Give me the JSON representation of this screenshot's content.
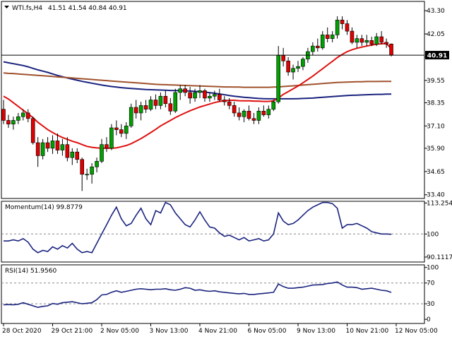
{
  "colors": {
    "bull": "#00a000",
    "bear": "#e00000",
    "ma_fast": "#e01010",
    "ma_mid": "#a0522d",
    "ma_slow": "#1a237e",
    "indicator": "#1a237e",
    "grid": "#888888"
  },
  "chart_data": [
    {
      "type": "candlestick",
      "title": "WTI.fs,H4",
      "ohlc_text": "41.51 41.54 40.84 40.91",
      "current_price_label": "40.91",
      "current_price": 40.91,
      "ylim": [
        33.2,
        43.8
      ],
      "yticks": [
        "43.30",
        "42.05",
        "40.80",
        "39.55",
        "38.35",
        "37.10",
        "35.90",
        "34.65",
        "33.40"
      ],
      "ytick_values": [
        43.3,
        42.05,
        40.8,
        39.55,
        38.35,
        37.1,
        35.9,
        34.65,
        33.4
      ],
      "xticks": [
        "28 Oct 2020",
        "29 Oct 21:00",
        "2 Nov 05:00",
        "3 Nov 13:00",
        "4 Nov 21:00",
        "6 Nov 05:00",
        "9 Nov 13:00",
        "10 Nov 21:00",
        "12 Nov 05:00"
      ],
      "xtick_index": [
        0,
        10,
        20,
        30,
        40,
        50,
        60,
        70,
        80
      ],
      "candles": [
        [
          38.0,
          38.5,
          37.2,
          37.4
        ],
        [
          37.4,
          37.7,
          37.0,
          37.2
        ],
        [
          37.2,
          37.6,
          36.9,
          37.4
        ],
        [
          37.4,
          37.8,
          37.2,
          37.6
        ],
        [
          37.6,
          38.0,
          37.4,
          37.8
        ],
        [
          37.8,
          38.0,
          37.3,
          37.5
        ],
        [
          37.5,
          37.6,
          36.1,
          36.2
        ],
        [
          36.2,
          36.5,
          34.9,
          35.5
        ],
        [
          35.5,
          36.4,
          35.3,
          36.2
        ],
        [
          36.2,
          36.5,
          35.7,
          35.9
        ],
        [
          35.9,
          36.6,
          35.6,
          36.3
        ],
        [
          36.3,
          36.7,
          35.6,
          35.8
        ],
        [
          35.8,
          36.4,
          35.5,
          36.1
        ],
        [
          36.1,
          36.5,
          35.2,
          35.4
        ],
        [
          35.4,
          35.9,
          35.0,
          35.7
        ],
        [
          35.7,
          35.9,
          35.1,
          35.3
        ],
        [
          35.3,
          35.4,
          33.6,
          34.5
        ],
        [
          34.5,
          34.8,
          34.2,
          34.5
        ],
        [
          34.5,
          35.1,
          34.0,
          34.9
        ],
        [
          34.9,
          35.4,
          34.6,
          35.2
        ],
        [
          35.2,
          36.4,
          35.1,
          36.1
        ],
        [
          36.1,
          36.5,
          35.7,
          35.9
        ],
        [
          35.9,
          37.2,
          35.8,
          37.0
        ],
        [
          37.0,
          37.4,
          36.6,
          36.9
        ],
        [
          36.9,
          37.2,
          36.5,
          36.7
        ],
        [
          36.7,
          37.3,
          36.4,
          37.1
        ],
        [
          37.1,
          38.3,
          37.0,
          38.1
        ],
        [
          38.1,
          38.5,
          37.5,
          37.8
        ],
        [
          37.8,
          38.4,
          37.4,
          38.2
        ],
        [
          38.2,
          38.5,
          37.8,
          38.0
        ],
        [
          38.0,
          38.7,
          37.9,
          38.5
        ],
        [
          38.5,
          38.8,
          38.0,
          38.2
        ],
        [
          38.2,
          38.9,
          38.0,
          38.7
        ],
        [
          38.7,
          39.0,
          38.1,
          38.3
        ],
        [
          38.3,
          38.6,
          37.7,
          37.9
        ],
        [
          37.9,
          39.1,
          37.8,
          38.9
        ],
        [
          38.9,
          39.3,
          38.5,
          39.1
        ],
        [
          39.1,
          39.3,
          38.7,
          38.9
        ],
        [
          38.9,
          39.2,
          38.3,
          38.6
        ],
        [
          38.6,
          39.1,
          38.4,
          38.9
        ],
        [
          38.9,
          39.3,
          38.6,
          39.0
        ],
        [
          39.0,
          39.1,
          38.4,
          38.6
        ],
        [
          38.6,
          38.9,
          38.4,
          38.7
        ],
        [
          38.7,
          39.0,
          38.5,
          38.8
        ],
        [
          38.8,
          39.1,
          38.4,
          38.5
        ],
        [
          38.5,
          38.7,
          38.2,
          38.4
        ],
        [
          38.4,
          38.6,
          38.0,
          38.2
        ],
        [
          38.2,
          38.4,
          37.6,
          37.8
        ],
        [
          37.8,
          38.1,
          37.4,
          37.6
        ],
        [
          37.6,
          38.0,
          37.3,
          37.9
        ],
        [
          37.9,
          38.2,
          37.4,
          37.5
        ],
        [
          37.5,
          37.8,
          37.2,
          37.4
        ],
        [
          37.4,
          38.1,
          37.2,
          37.9
        ],
        [
          37.9,
          38.2,
          37.6,
          37.7
        ],
        [
          37.7,
          38.2,
          37.5,
          38.0
        ],
        [
          38.0,
          38.5,
          37.9,
          38.4
        ],
        [
          38.4,
          41.4,
          38.3,
          40.9
        ],
        [
          40.9,
          41.3,
          40.3,
          40.6
        ],
        [
          40.6,
          40.8,
          39.8,
          40.0
        ],
        [
          40.0,
          40.4,
          39.6,
          40.2
        ],
        [
          40.2,
          40.6,
          40.0,
          40.3
        ],
        [
          40.3,
          40.8,
          40.1,
          40.7
        ],
        [
          40.7,
          41.3,
          40.5,
          41.1
        ],
        [
          41.1,
          41.6,
          40.9,
          41.4
        ],
        [
          41.4,
          41.8,
          41.1,
          41.3
        ],
        [
          41.3,
          42.2,
          41.2,
          42.0
        ],
        [
          42.0,
          42.4,
          41.6,
          41.8
        ],
        [
          41.8,
          42.2,
          41.6,
          42.0
        ],
        [
          42.0,
          43.0,
          41.8,
          42.8
        ],
        [
          42.8,
          43.0,
          42.3,
          42.6
        ],
        [
          42.6,
          42.8,
          42.0,
          42.2
        ],
        [
          42.2,
          42.4,
          41.5,
          41.6
        ],
        [
          41.6,
          42.0,
          41.3,
          41.8
        ],
        [
          41.8,
          42.0,
          41.4,
          41.6
        ],
        [
          41.6,
          42.0,
          41.4,
          41.7
        ],
        [
          41.7,
          41.9,
          41.4,
          41.5
        ],
        [
          41.5,
          42.1,
          41.4,
          41.9
        ],
        [
          41.9,
          42.2,
          41.5,
          41.6
        ],
        [
          41.6,
          41.8,
          41.3,
          41.51
        ],
        [
          41.51,
          41.54,
          40.84,
          40.91
        ]
      ],
      "ma_fast": [
        38.7,
        38.55,
        38.35,
        38.15,
        37.95,
        37.75,
        37.55,
        37.3,
        37.1,
        36.9,
        36.75,
        36.6,
        36.48,
        36.38,
        36.28,
        36.2,
        36.1,
        36.0,
        35.95,
        35.92,
        35.9,
        35.9,
        35.9,
        35.92,
        35.98,
        36.05,
        36.15,
        36.28,
        36.42,
        36.58,
        36.75,
        36.92,
        37.1,
        37.25,
        37.4,
        37.55,
        37.68,
        37.8,
        37.92,
        38.02,
        38.12,
        38.2,
        38.28,
        38.36,
        38.42,
        38.46,
        38.48,
        38.48,
        38.46,
        38.45,
        38.45,
        38.44,
        38.43,
        38.42,
        38.42,
        38.45,
        38.6,
        38.8,
        38.95,
        39.1,
        39.25,
        39.42,
        39.6,
        39.78,
        39.98,
        40.18,
        40.38,
        40.58,
        40.78,
        40.95,
        41.1,
        41.2,
        41.28,
        41.34,
        41.4,
        41.45,
        41.5,
        41.52,
        41.53,
        41.25
      ],
      "ma_mid": [
        39.95,
        39.93,
        39.92,
        39.9,
        39.88,
        39.86,
        39.84,
        39.82,
        39.8,
        39.78,
        39.76,
        39.74,
        39.72,
        39.7,
        39.68,
        39.66,
        39.64,
        39.62,
        39.6,
        39.58,
        39.56,
        39.54,
        39.52,
        39.5,
        39.48,
        39.46,
        39.44,
        39.42,
        39.4,
        39.38,
        39.36,
        39.34,
        39.33,
        39.32,
        39.31,
        39.3,
        39.29,
        39.28,
        39.27,
        39.26,
        39.25,
        39.24,
        39.23,
        39.22,
        39.21,
        39.2,
        39.2,
        39.19,
        39.19,
        39.18,
        39.18,
        39.18,
        39.18,
        39.18,
        39.18,
        39.19,
        39.2,
        39.22,
        39.24,
        39.26,
        39.28,
        39.3,
        39.32,
        39.34,
        39.36,
        39.38,
        39.4,
        39.42,
        39.44,
        39.45,
        39.46,
        39.47,
        39.48,
        39.48,
        39.49,
        39.49,
        39.49,
        39.5,
        39.5,
        39.5
      ],
      "ma_slow": [
        40.55,
        40.5,
        40.45,
        40.4,
        40.35,
        40.28,
        40.2,
        40.12,
        40.05,
        39.98,
        39.9,
        39.82,
        39.75,
        39.68,
        39.62,
        39.56,
        39.5,
        39.45,
        39.4,
        39.35,
        39.3,
        39.26,
        39.22,
        39.19,
        39.16,
        39.14,
        39.12,
        39.1,
        39.08,
        39.06,
        39.05,
        39.04,
        39.03,
        39.02,
        39.01,
        39.0,
        39.0,
        38.99,
        38.98,
        38.96,
        38.94,
        38.92,
        38.89,
        38.86,
        38.82,
        38.78,
        38.74,
        38.7,
        38.67,
        38.64,
        38.62,
        38.6,
        38.58,
        38.57,
        38.56,
        38.56,
        38.56,
        38.56,
        38.56,
        38.56,
        38.57,
        38.58,
        38.59,
        38.6,
        38.62,
        38.64,
        38.66,
        38.68,
        38.7,
        38.72,
        38.74,
        38.75,
        38.76,
        38.77,
        38.78,
        38.79,
        38.8,
        38.8,
        38.81,
        38.81
      ]
    },
    {
      "type": "line",
      "title": "Momentum(14) 99.8779",
      "ylim": [
        88.0,
        114.0
      ],
      "yticks": [
        "113.2541",
        "100",
        "90.1117"
      ],
      "ytick_values": [
        113.2541,
        100,
        90.1117
      ],
      "reference_line": 100,
      "values": [
        97.0,
        97.0,
        97.5,
        97.0,
        98.0,
        96.5,
        93.5,
        92.0,
        93.0,
        92.5,
        94.5,
        93.5,
        95.0,
        94.0,
        96.0,
        93.5,
        92.0,
        92.5,
        92.0,
        96.0,
        100.0,
        104.0,
        108.0,
        111.5,
        106.5,
        103.5,
        104.5,
        108.0,
        111.0,
        106.5,
        104.0,
        110.0,
        109.0,
        113.5,
        112.5,
        109.0,
        106.5,
        104.0,
        103.0,
        106.0,
        109.5,
        106.0,
        103.0,
        102.5,
        100.5,
        99.0,
        99.5,
        98.5,
        97.5,
        98.5,
        97.0,
        97.5,
        98.0,
        97.0,
        97.5,
        100.0,
        109.0,
        105.5,
        104.0,
        104.5,
        106.0,
        108.0,
        110.0,
        111.5,
        112.5,
        113.5,
        113.5,
        113.0,
        111.0,
        102.5,
        104.0,
        104.0,
        104.5,
        103.5,
        102.5,
        101.0,
        100.5,
        100.0,
        100.0,
        99.8779
      ]
    },
    {
      "type": "line",
      "title": "RSI(14) 51.9560",
      "ylim": [
        -8,
        105
      ],
      "yticks": [
        "100",
        "70",
        "30",
        "0"
      ],
      "ytick_values": [
        100,
        70,
        30,
        0
      ],
      "levels": [
        70,
        30
      ],
      "values": [
        28.0,
        28.5,
        28.0,
        29.0,
        32.0,
        29.0,
        26.0,
        23.0,
        25.0,
        26.0,
        30.5,
        29.0,
        32.0,
        33.0,
        34.0,
        32.0,
        30.0,
        31.0,
        32.0,
        38.0,
        47.0,
        48.0,
        52.0,
        55.0,
        52.0,
        54.0,
        56.0,
        58.0,
        59.0,
        58.0,
        57.0,
        58.0,
        58.0,
        59.0,
        57.0,
        56.0,
        58.0,
        61.0,
        60.0,
        56.0,
        57.0,
        55.0,
        54.0,
        55.0,
        53.0,
        52.0,
        51.0,
        50.0,
        49.0,
        50.0,
        48.0,
        48.0,
        49.0,
        50.0,
        51.0,
        52.0,
        68.0,
        63.0,
        60.0,
        60.0,
        61.0,
        62.0,
        64.0,
        66.0,
        66.5,
        67.0,
        69.0,
        70.0,
        72.0,
        66.0,
        62.0,
        62.0,
        61.0,
        58.0,
        59.0,
        60.0,
        58.0,
        56.0,
        55.0,
        51.956
      ]
    }
  ]
}
